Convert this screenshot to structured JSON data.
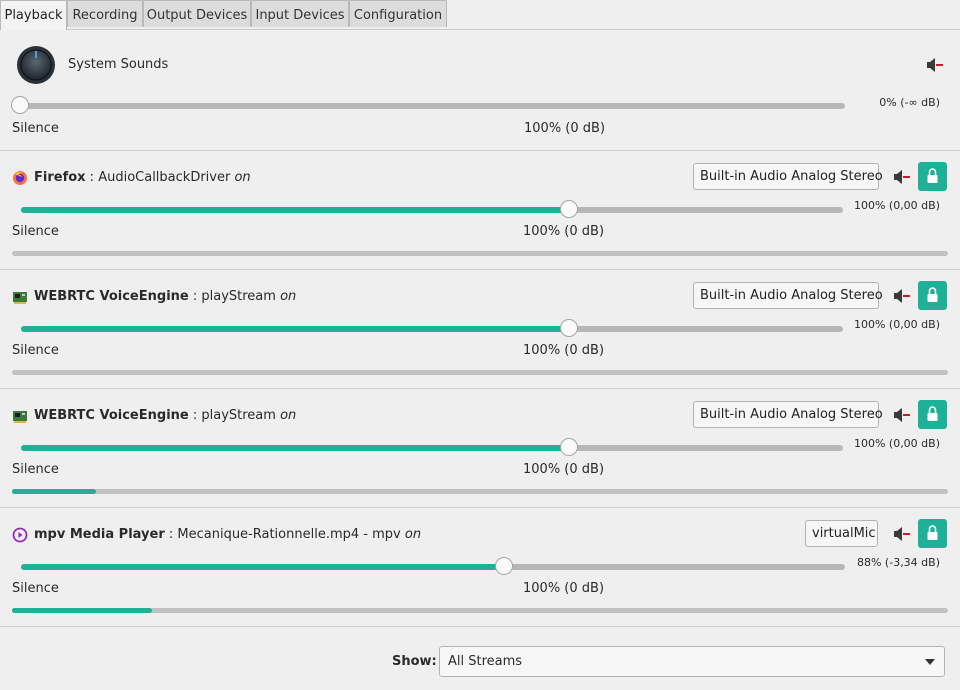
{
  "tabs": [
    "Playback",
    "Recording",
    "Output Devices",
    "Input Devices",
    "Configuration"
  ],
  "active_tab": "Playback",
  "colors": {
    "accent": "#1fb197",
    "mute_red": "#c0202a",
    "track": "#b7b7b7"
  },
  "system": {
    "name": "System Sounds",
    "icon": "knob-icon",
    "volume_percent": 0,
    "volume_readout": "0% (-∞ dB)",
    "scale_left": "Silence",
    "scale_mid": "100% (0 dB)"
  },
  "streams": [
    {
      "app": "Firefox",
      "separator": " : ",
      "stream": "AudioCallbackDriver",
      "state": "on",
      "icon": "firefox-icon",
      "device": "Built-in Audio Analog Stereo",
      "volume_percent": 100,
      "volume_readout": "100% (0,00 dB)",
      "scale_left": "Silence",
      "scale_mid": "100% (0 dB)",
      "level": 0
    },
    {
      "app": "WEBRTC VoiceEngine",
      "separator": " : ",
      "stream": "playStream",
      "state": "on",
      "icon": "network-card-icon",
      "device": "Built-in Audio Analog Stereo",
      "volume_percent": 100,
      "volume_readout": "100% (0,00 dB)",
      "scale_left": "Silence",
      "scale_mid": "100% (0 dB)",
      "level": 0
    },
    {
      "app": "WEBRTC VoiceEngine",
      "separator": " : ",
      "stream": "playStream",
      "state": "on",
      "icon": "network-card-icon",
      "device": "Built-in Audio Analog Stereo",
      "volume_percent": 100,
      "volume_readout": "100% (0,00 dB)",
      "scale_left": "Silence",
      "scale_mid": "100% (0 dB)",
      "level": 0.09
    },
    {
      "app": "mpv Media Player",
      "separator": " : ",
      "stream": "Mecanique-Rationnelle.mp4 - mpv",
      "state": "on",
      "icon": "mpv-play-icon",
      "device": "virtualMic",
      "volume_percent": 88,
      "volume_readout": "88% (-3,34 dB)",
      "scale_left": "Silence",
      "scale_mid": "100% (0 dB)",
      "level": 0.15
    }
  ],
  "filter": {
    "label": "Show:",
    "value": "All Streams"
  }
}
